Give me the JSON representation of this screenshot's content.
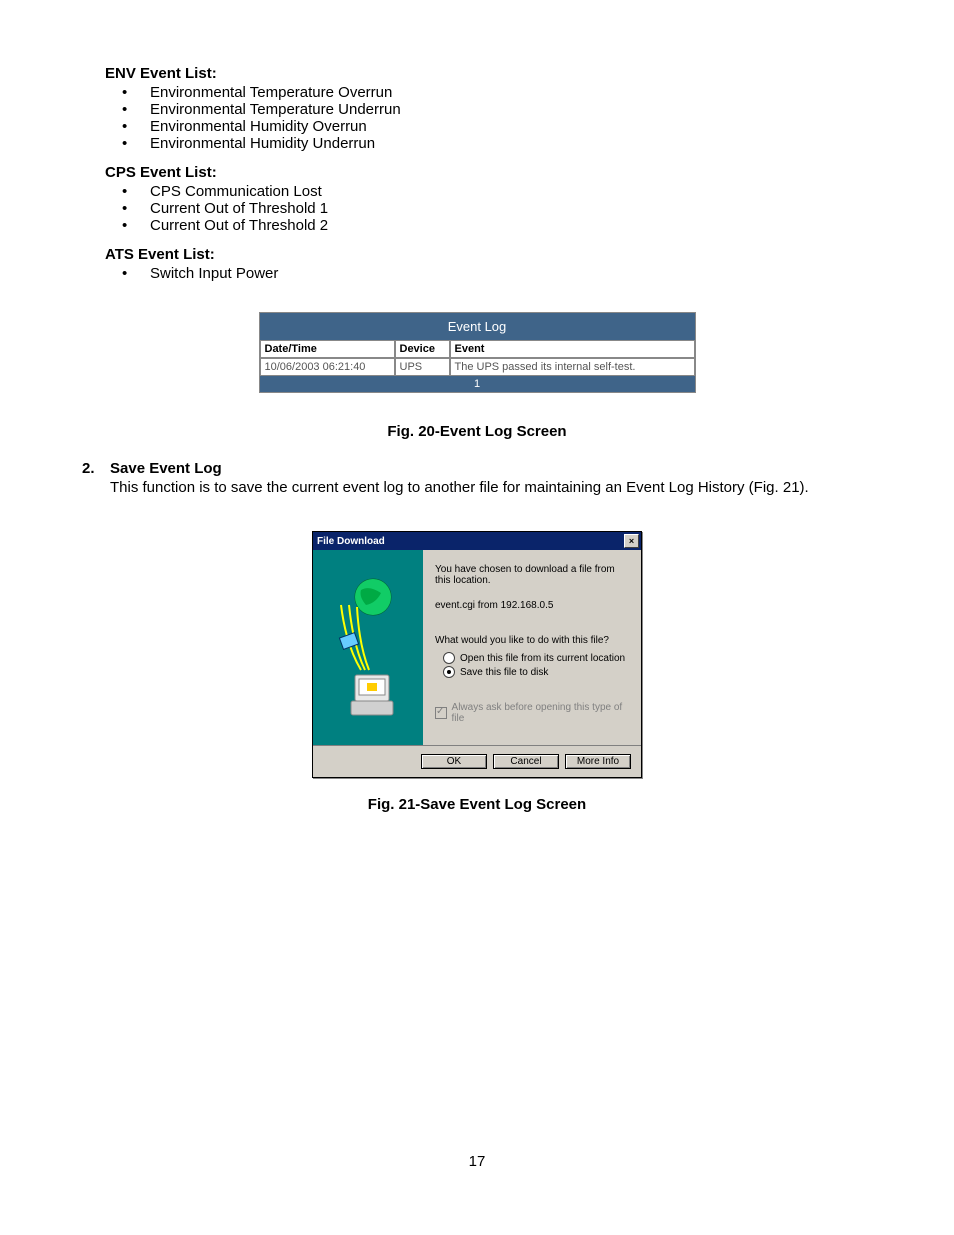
{
  "env": {
    "heading": "ENV Event List:",
    "items": [
      "Environmental Temperature Overrun",
      "Environmental Temperature Underrun",
      "Environmental Humidity Overrun",
      "Environmental Humidity Underrun"
    ]
  },
  "cps": {
    "heading": "CPS Event List:",
    "items": [
      "CPS Communication Lost",
      "Current Out of Threshold 1",
      "Current Out of Threshold 2"
    ]
  },
  "ats": {
    "heading": "ATS Event List:",
    "items": [
      "Switch Input Power"
    ]
  },
  "eventlog": {
    "title": "Event Log",
    "headers": {
      "dt": "Date/Time",
      "dev": "Device",
      "ev": "Event"
    },
    "row": {
      "dt": "10/06/2003 06:21:40",
      "dev": "UPS",
      "ev": "The UPS passed its internal self-test."
    },
    "footer": "1"
  },
  "fig20": "Fig. 20-Event Log Screen",
  "section2": {
    "num": "2.",
    "title": "Save Event Log",
    "desc": "This function is to save the current event log to another file for maintaining an Event Log History (Fig. 21)."
  },
  "dialog": {
    "title": "File Download",
    "line1": "You have chosen to download a file from this location.",
    "line2": "event.cgi from 192.168.0.5",
    "question": "What would you like to do with this file?",
    "opt1": "Open this file from its current location",
    "opt2": "Save this file to disk",
    "check": "Always ask before opening this type of file",
    "buttons": {
      "ok": "OK",
      "cancel": "Cancel",
      "more": "More Info"
    }
  },
  "fig21": "Fig. 21-Save Event Log Screen",
  "pageNum": "17"
}
